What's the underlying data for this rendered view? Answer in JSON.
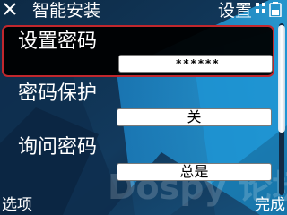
{
  "header": {
    "title": "智能安装",
    "right_title": "设置",
    "icons": [
      "exit-icon",
      "indicator-icon",
      "battery-icon"
    ]
  },
  "settings": {
    "items": [
      {
        "label": "设置密码",
        "value": "******",
        "selected": true
      },
      {
        "label": "密码保护",
        "value": "关",
        "selected": false
      },
      {
        "label": "询问密码",
        "value": "总是",
        "selected": false
      }
    ]
  },
  "softkeys": {
    "left": "选项",
    "right": "完成"
  },
  "watermark": "Dospy 论坛",
  "colors": {
    "background": "#0c1f33",
    "accent_blue": "#1e8fd0",
    "selection_border": "#c1272d",
    "text": "#ffffff"
  }
}
